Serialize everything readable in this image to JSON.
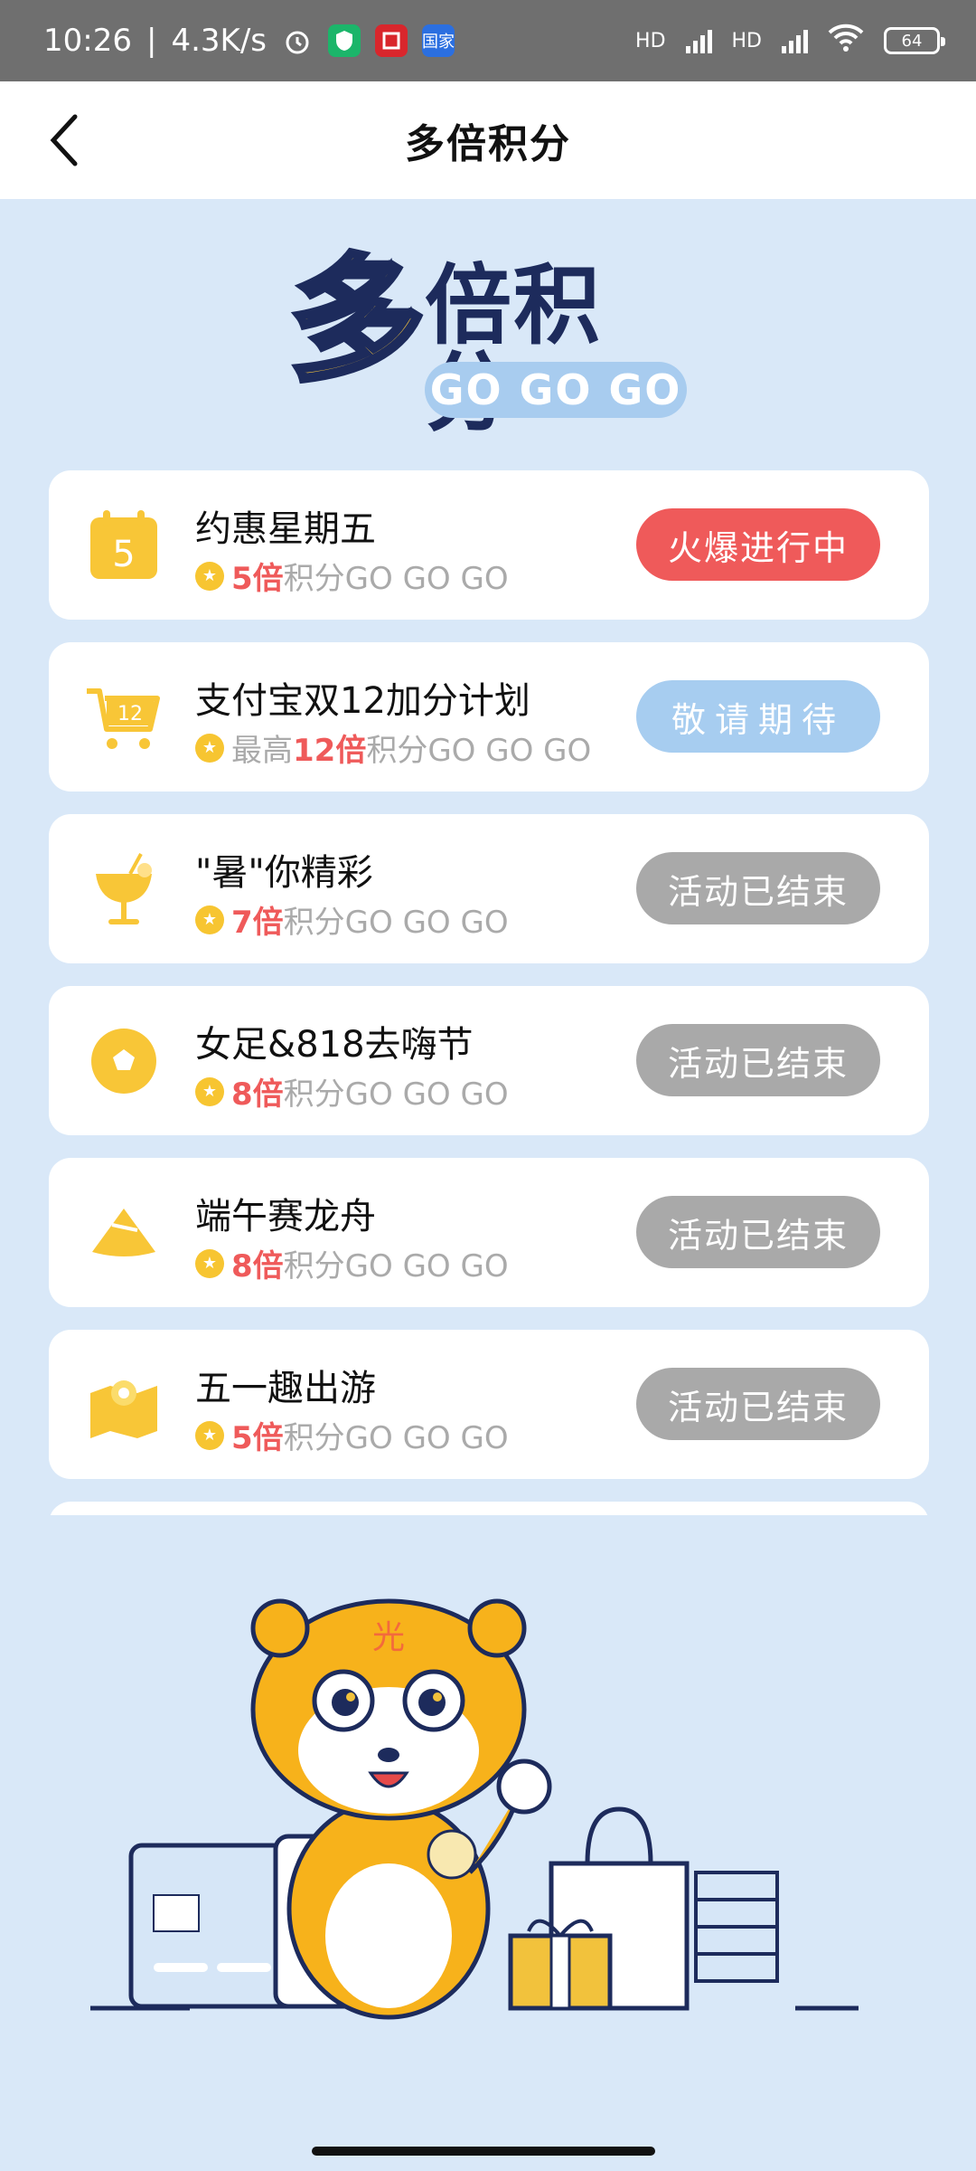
{
  "status": {
    "time": "10:26",
    "speed": "4.3K/s",
    "battery": "64",
    "net1": "HD",
    "net2": "HD",
    "app_icon_label": "国家"
  },
  "nav": {
    "title": "多倍积分"
  },
  "hero": {
    "big_char": "多",
    "rest": "倍积分",
    "go": "GO GO GO"
  },
  "activities": [
    {
      "title": "约惠星期五",
      "prefix": "",
      "mult": "5倍",
      "suffix": "积分GO GO GO",
      "status": "火爆进行中",
      "state": "active",
      "icon": "calendar-icon",
      "icon_text": "5"
    },
    {
      "title": "支付宝双12加分计划",
      "prefix": "最高",
      "mult": "12倍",
      "suffix": "积分GO GO GO",
      "status": "敬请期待",
      "state": "soon",
      "icon": "shopping-cart-icon",
      "icon_text": "12"
    },
    {
      "title": "\"暑\"你精彩",
      "prefix": "",
      "mult": "7倍",
      "suffix": "积分GO GO GO",
      "status": "活动已结束",
      "state": "ended",
      "icon": "drink-icon",
      "icon_text": ""
    },
    {
      "title": "女足&818去嗨节",
      "prefix": "",
      "mult": "8倍",
      "suffix": "积分GO GO GO",
      "status": "活动已结束",
      "state": "ended",
      "icon": "soccer-ball-icon",
      "icon_text": ""
    },
    {
      "title": "端午赛龙舟",
      "prefix": "",
      "mult": "8倍",
      "suffix": "积分GO GO GO",
      "status": "活动已结束",
      "state": "ended",
      "icon": "zongzi-icon",
      "icon_text": ""
    },
    {
      "title": "五一趣出游",
      "prefix": "",
      "mult": "5倍",
      "suffix": "积分GO GO GO",
      "status": "活动已结束",
      "state": "ended",
      "icon": "map-pin-icon",
      "icon_text": ""
    }
  ],
  "mascot": {
    "badge_char": "光"
  }
}
